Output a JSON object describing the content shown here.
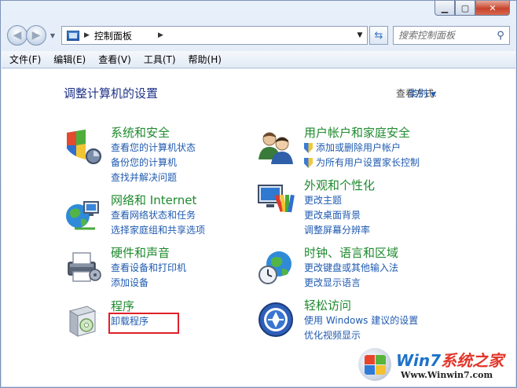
{
  "window": {
    "address": "控制面板",
    "search_placeholder": "搜索控制面板"
  },
  "menu": [
    "文件(F)",
    "编辑(E)",
    "查看(V)",
    "工具(T)",
    "帮助(H)"
  ],
  "main": {
    "title": "调整计算机的设置",
    "view_by_label": "查看方式:",
    "view_by_value": "类别"
  },
  "categories": [
    {
      "title": "系统和安全",
      "links": [
        "查看您的计算机状态",
        "备份您的计算机",
        "查找并解决问题"
      ]
    },
    {
      "title": "网络和 Internet",
      "links": [
        "查看网络状态和任务",
        "选择家庭组和共享选项"
      ]
    },
    {
      "title": "硬件和声音",
      "links": [
        "查看设备和打印机",
        "添加设备"
      ]
    },
    {
      "title": "程序",
      "links": [
        "卸载程序"
      ]
    },
    {
      "title": "用户帐户和家庭安全",
      "links": [
        "添加或删除用户帐户",
        "为所有用户设置家长控制"
      ]
    },
    {
      "title": "外观和个性化",
      "links": [
        "更改主题",
        "更改桌面背景",
        "调整屏幕分辨率"
      ]
    },
    {
      "title": "时钟、语言和区域",
      "links": [
        "更改键盘或其他输入法",
        "更改显示语言"
      ]
    },
    {
      "title": "轻松访问",
      "links": [
        "使用 Windows 建议的设置",
        "优化视频显示"
      ]
    }
  ],
  "watermark": {
    "brand_win": "Win7",
    "brand_rest": "系统之家",
    "url": "Www.Winwin7.com"
  },
  "icons": {
    "back": "back-arrow-icon",
    "forward": "forward-arrow-icon",
    "refresh": "refresh-icon",
    "search": "search-icon"
  }
}
